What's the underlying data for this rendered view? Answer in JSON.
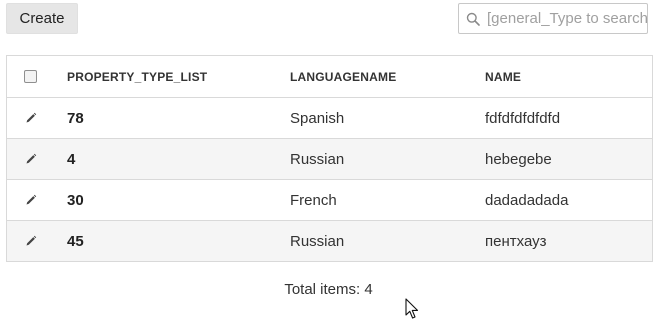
{
  "toolbar": {
    "create_label": "Create"
  },
  "search": {
    "placeholder": "[general_Type to search]",
    "value": ""
  },
  "grid": {
    "columns": [
      "PROPERTY_TYPE_LIST",
      "LANGUAGENAME",
      "NAME"
    ],
    "rows": [
      {
        "id": "78",
        "language": "Spanish",
        "name": "fdfdfdfdfdfd"
      },
      {
        "id": "4",
        "language": "Russian",
        "name": "hebegebe"
      },
      {
        "id": "30",
        "language": "French",
        "name": "dadadadada"
      },
      {
        "id": "45",
        "language": "Russian",
        "name": "пентхауз"
      }
    ]
  },
  "footer": {
    "total_label": "Total items: 4"
  },
  "icons": {
    "search": "search-icon",
    "edit": "pencil-icon",
    "cursor": "mouse-pointer-icon"
  }
}
